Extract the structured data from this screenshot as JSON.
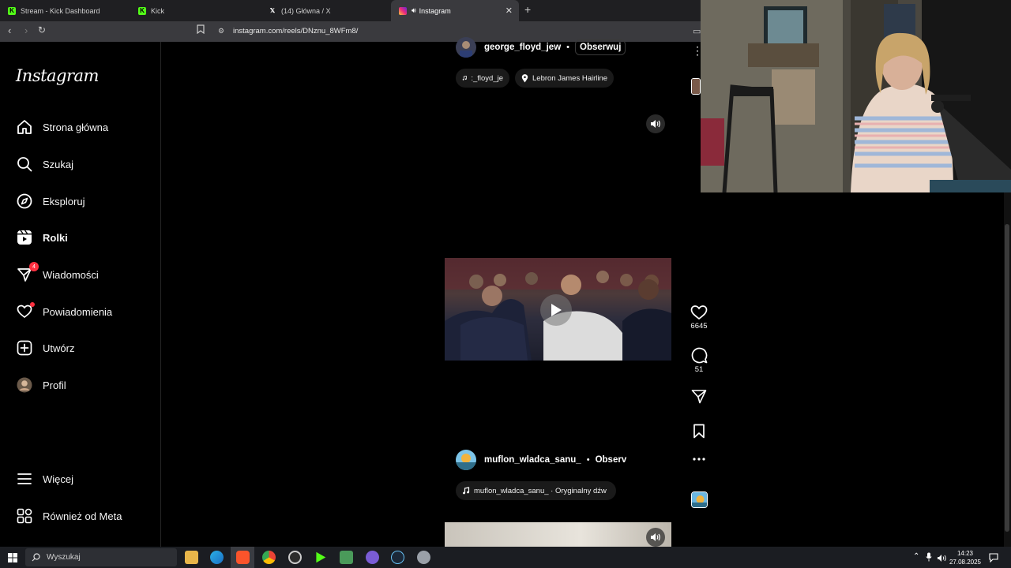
{
  "browser": {
    "tabs": [
      {
        "label": "Stream - Kick Dashboard",
        "active": false
      },
      {
        "label": "Kick",
        "active": false
      },
      {
        "label": "(14) Główna / X",
        "active": false
      },
      {
        "label": "Instagram",
        "active": true
      }
    ],
    "url": "instagram.com/reels/DNznu_8WFm8/"
  },
  "sidebar": {
    "logo": "Instagram",
    "items": [
      {
        "label": "Strona główna",
        "icon": "home-icon"
      },
      {
        "label": "Szukaj",
        "icon": "search-icon"
      },
      {
        "label": "Eksploruj",
        "icon": "compass-icon"
      },
      {
        "label": "Rolki",
        "icon": "reels-icon"
      },
      {
        "label": "Wiadomości",
        "icon": "messages-icon",
        "badge": "4"
      },
      {
        "label": "Powiadomienia",
        "icon": "heart-icon"
      },
      {
        "label": "Utwórz",
        "icon": "plus-icon"
      },
      {
        "label": "Profil",
        "icon": "avatar-icon"
      }
    ],
    "more": "Więcej",
    "meta": "Również od Meta"
  },
  "reel1": {
    "username": "george_floyd_jew",
    "separator": "•",
    "follow": "Obserwuj",
    "audio": ":_floyd_je",
    "location": "Lebron James Hairline",
    "likes": "6645",
    "comments": "51"
  },
  "reel2": {
    "username": "muflon_wladca_sanu_",
    "separator": "•",
    "follow": "Observ",
    "audio": "muflon_wladca_sanu_ · Oryginalny dźw"
  },
  "taskbar": {
    "search_placeholder": "Wyszukaj",
    "time": "14:23",
    "date": "27.08.2025"
  },
  "colors": {
    "accent_red": "#ff3040",
    "background": "#000000",
    "kick_green": "#53fc18"
  }
}
